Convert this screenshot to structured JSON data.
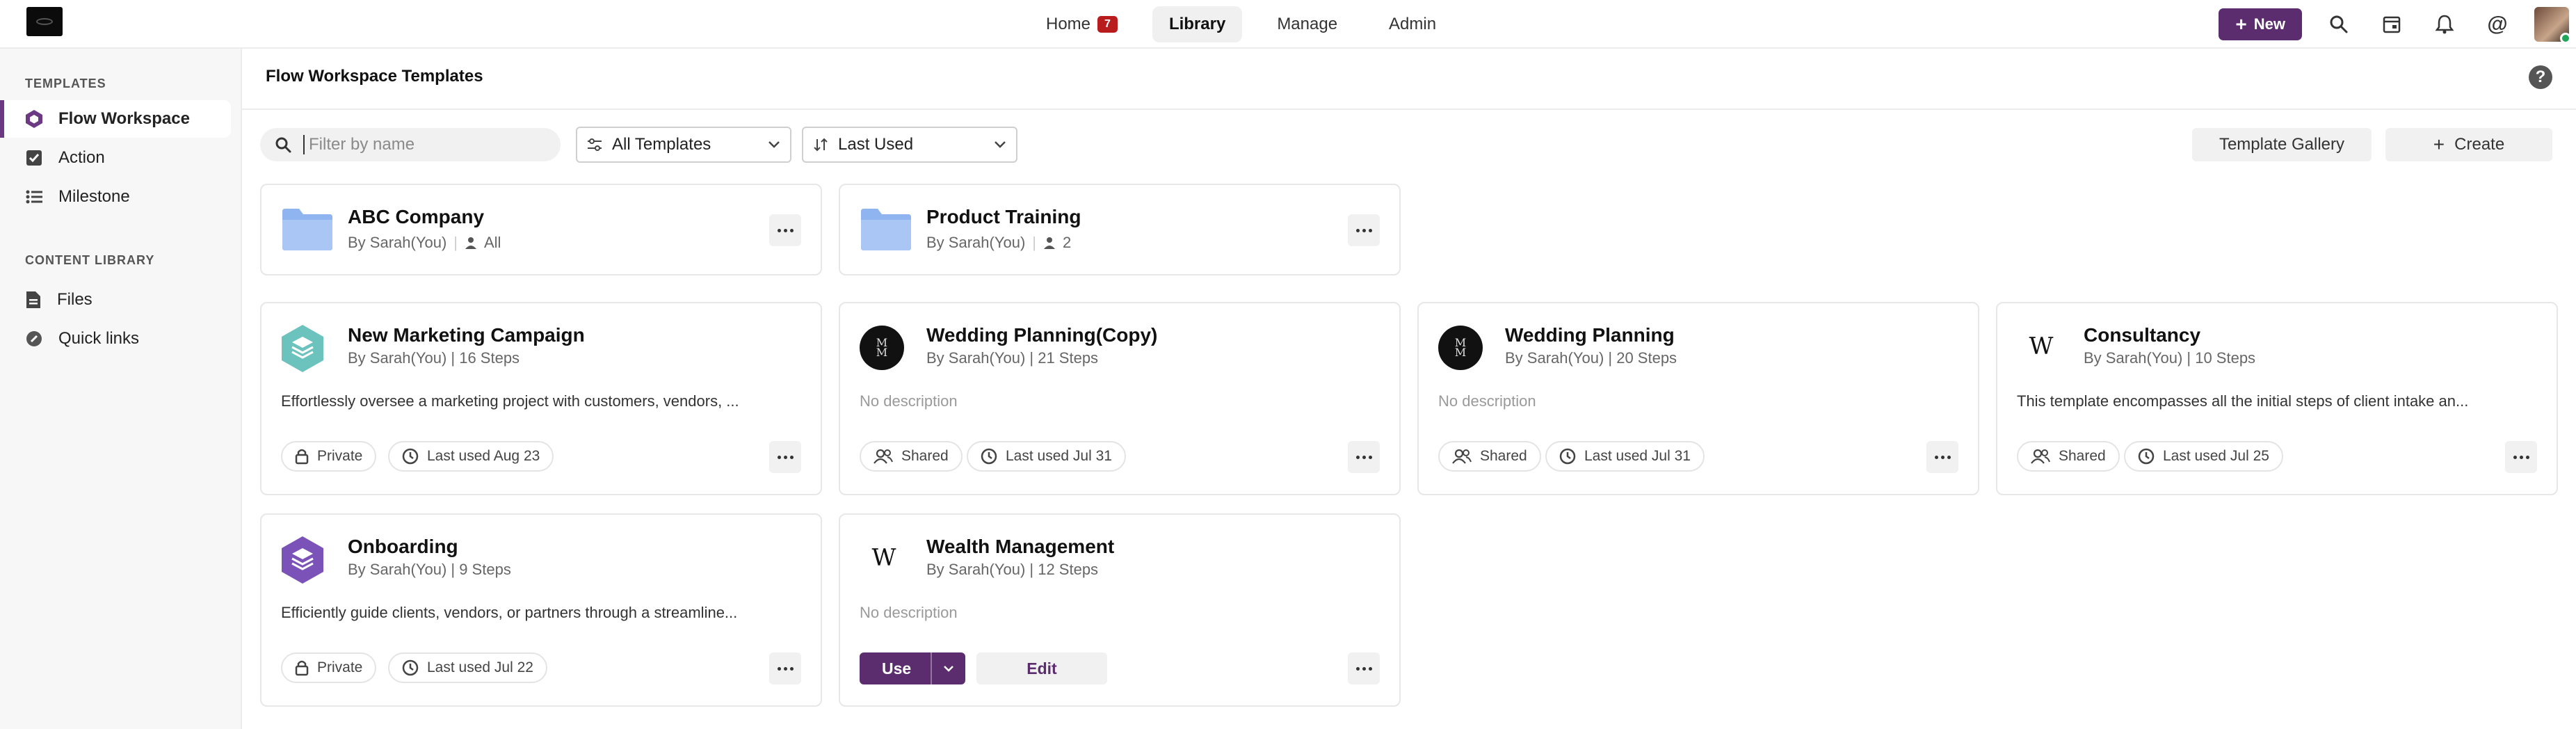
{
  "app": {
    "logo": "brand-logo"
  },
  "nav": {
    "items": [
      {
        "label": "Home",
        "badge": "7"
      },
      {
        "label": "Library",
        "active": true
      },
      {
        "label": "Manage"
      },
      {
        "label": "Admin"
      }
    ]
  },
  "toolbar": {
    "new_label": "New"
  },
  "sidebar": {
    "templates_heading": "TEMPLATES",
    "templates": [
      {
        "label": "Flow Workspace",
        "icon": "hexagon-icon",
        "active": true
      },
      {
        "label": "Action",
        "icon": "checkbox-icon"
      },
      {
        "label": "Milestone",
        "icon": "list-icon"
      }
    ],
    "content_heading": "CONTENT LIBRARY",
    "content": [
      {
        "label": "Files",
        "icon": "file-icon"
      },
      {
        "label": "Quick links",
        "icon": "link-icon"
      }
    ]
  },
  "main": {
    "title": "Flow Workspace Templates",
    "filter_placeholder": "Filter by name",
    "type_select": "All Templates",
    "sort_select": "Last Used",
    "gallery_label": "Template Gallery",
    "create_label": "Create"
  },
  "folders": [
    {
      "name": "ABC Company",
      "by": "By Sarah(You)",
      "members": "All"
    },
    {
      "name": "Product Training",
      "by": "By Sarah(You)",
      "members": "2"
    }
  ],
  "templates": [
    {
      "name": "New Marketing Campaign",
      "meta": "By Sarah(You) | 16 Steps",
      "desc": "Effortlessly oversee a marketing project with customers, vendors, ...",
      "visibility": "Private",
      "last_used": "Last used Aug 23",
      "logo": "teal-layers-logo"
    },
    {
      "name": "Wedding Planning(Copy)",
      "meta": "By Sarah(You) | 21 Steps",
      "desc": "No description",
      "visibility": "Shared",
      "last_used": "Last used Jul 31",
      "logo": "monogram-logo"
    },
    {
      "name": "Wedding Planning",
      "meta": "By Sarah(You) | 20 Steps",
      "desc": "No description",
      "visibility": "Shared",
      "last_used": "Last used Jul 31",
      "logo": "monogram-logo"
    },
    {
      "name": "Consultancy",
      "meta": "By Sarah(You) | 10 Steps",
      "desc": "This template encompasses all the initial steps of client intake an...",
      "visibility": "Shared",
      "last_used": "Last used Jul 25",
      "logo": "wx-logo"
    },
    {
      "name": "Onboarding",
      "meta": "By Sarah(You) | 9 Steps",
      "desc": "Efficiently guide clients, vendors, or partners through a streamline...",
      "visibility": "Private",
      "last_used": "Last used Jul 22",
      "logo": "purple-layers-logo"
    },
    {
      "name": "Wealth Management",
      "meta": "By Sarah(You) | 12 Steps",
      "desc": "No description",
      "use_label": "Use",
      "edit_label": "Edit",
      "logo": "wx-logo"
    }
  ],
  "colors": {
    "accent": "#5b2d6f",
    "badge": "#b91c1c",
    "teal": "#6cc3bd",
    "purple": "#7b52b8",
    "folder": "#8fb4ef"
  }
}
